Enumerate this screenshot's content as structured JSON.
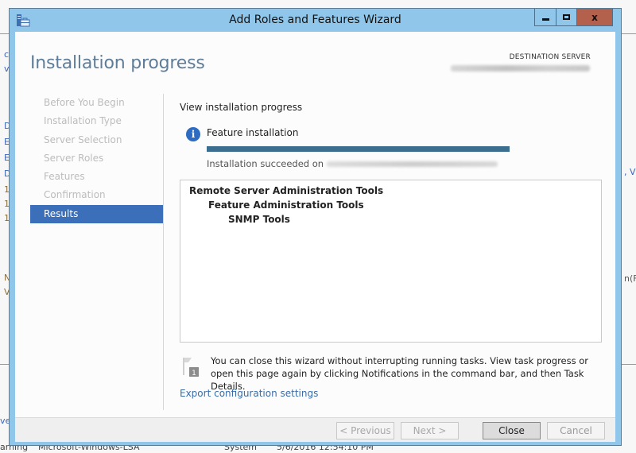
{
  "window": {
    "title": "Add Roles and Features Wizard",
    "app_icon": "server-manager-icon",
    "controls": {
      "minimize_icon": "minimize-icon",
      "maximize_icon": "maximize-icon",
      "close_glyph": "x"
    }
  },
  "header": {
    "page_title": "Installation progress",
    "destination_label": "DESTINATION SERVER",
    "destination_value": ""
  },
  "nav": {
    "items": [
      {
        "label": "Before You Begin",
        "active": false
      },
      {
        "label": "Installation Type",
        "active": false
      },
      {
        "label": "Server Selection",
        "active": false
      },
      {
        "label": "Server Roles",
        "active": false
      },
      {
        "label": "Features",
        "active": false
      },
      {
        "label": "Confirmation",
        "active": false
      },
      {
        "label": "Results",
        "active": true
      }
    ]
  },
  "content": {
    "section_heading": "View installation progress",
    "feature_label": "Feature installation",
    "progress_fraction": 1.0,
    "status_text": "Installation succeeded on",
    "results": [
      {
        "label": "Remote Server Administration Tools",
        "level": 0
      },
      {
        "label": "Feature Administration Tools",
        "level": 1
      },
      {
        "label": "SNMP Tools",
        "level": 2
      }
    ],
    "note_badge": "1",
    "note_text": "You can close this wizard without interrupting running tasks. View task progress or open this page again by clicking Notifications in the command bar, and then Task Details.",
    "export_link": "Export configuration settings"
  },
  "footer": {
    "previous_label": "< Previous",
    "next_label": "Next >",
    "close_label": "Close",
    "cancel_label": "Cancel"
  },
  "background": {
    "fragments_left": [
      "c",
      "v",
      "D",
      "E",
      "E",
      "D",
      "1",
      "1",
      "1",
      "N",
      "V"
    ],
    "fragment_right_top": ", V",
    "fragment_right_mid": "n(F",
    "fragment_left_bottom": "ve",
    "bottom_row": [
      "arning",
      "Microsoft-Windows-LSA",
      "System",
      "5/6/2016 12:54:10 PM"
    ]
  },
  "colors": {
    "titlebar": "#8fc6ea",
    "close_button": "#b3614c",
    "nav_active": "#3c6fb9",
    "progress": "#3c6e90",
    "link": "#3a6da8",
    "page_title": "#5f7d99"
  }
}
